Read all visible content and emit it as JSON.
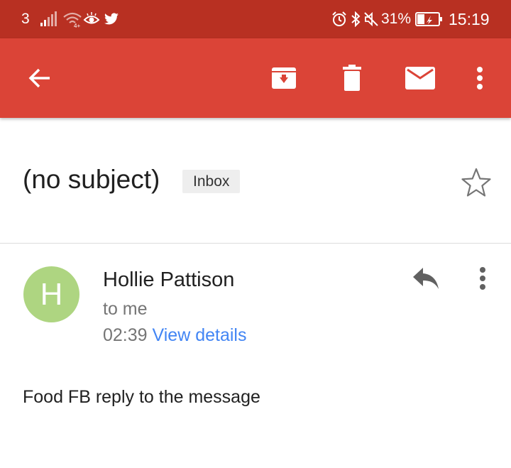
{
  "status_bar": {
    "carrier": "3",
    "battery_percent": "31%",
    "time": "15:19",
    "icons": [
      "signal-icon",
      "wifi-icon",
      "eye-icon",
      "twitter-icon",
      "alarm-icon",
      "bluetooth-icon",
      "mute-icon",
      "battery-icon"
    ]
  },
  "app_bar": {
    "color": "#db4437",
    "actions": [
      "back-icon",
      "archive-icon",
      "delete-icon",
      "mark-unread-icon",
      "more-icon"
    ]
  },
  "message": {
    "subject": "(no subject)",
    "label": "Inbox",
    "sender": "Hollie Pattison",
    "avatar_letter": "H",
    "avatar_color": "#aed581",
    "recipient": "to me",
    "time": "02:39",
    "details_link": "View details",
    "body": "Food FB reply to the message"
  }
}
